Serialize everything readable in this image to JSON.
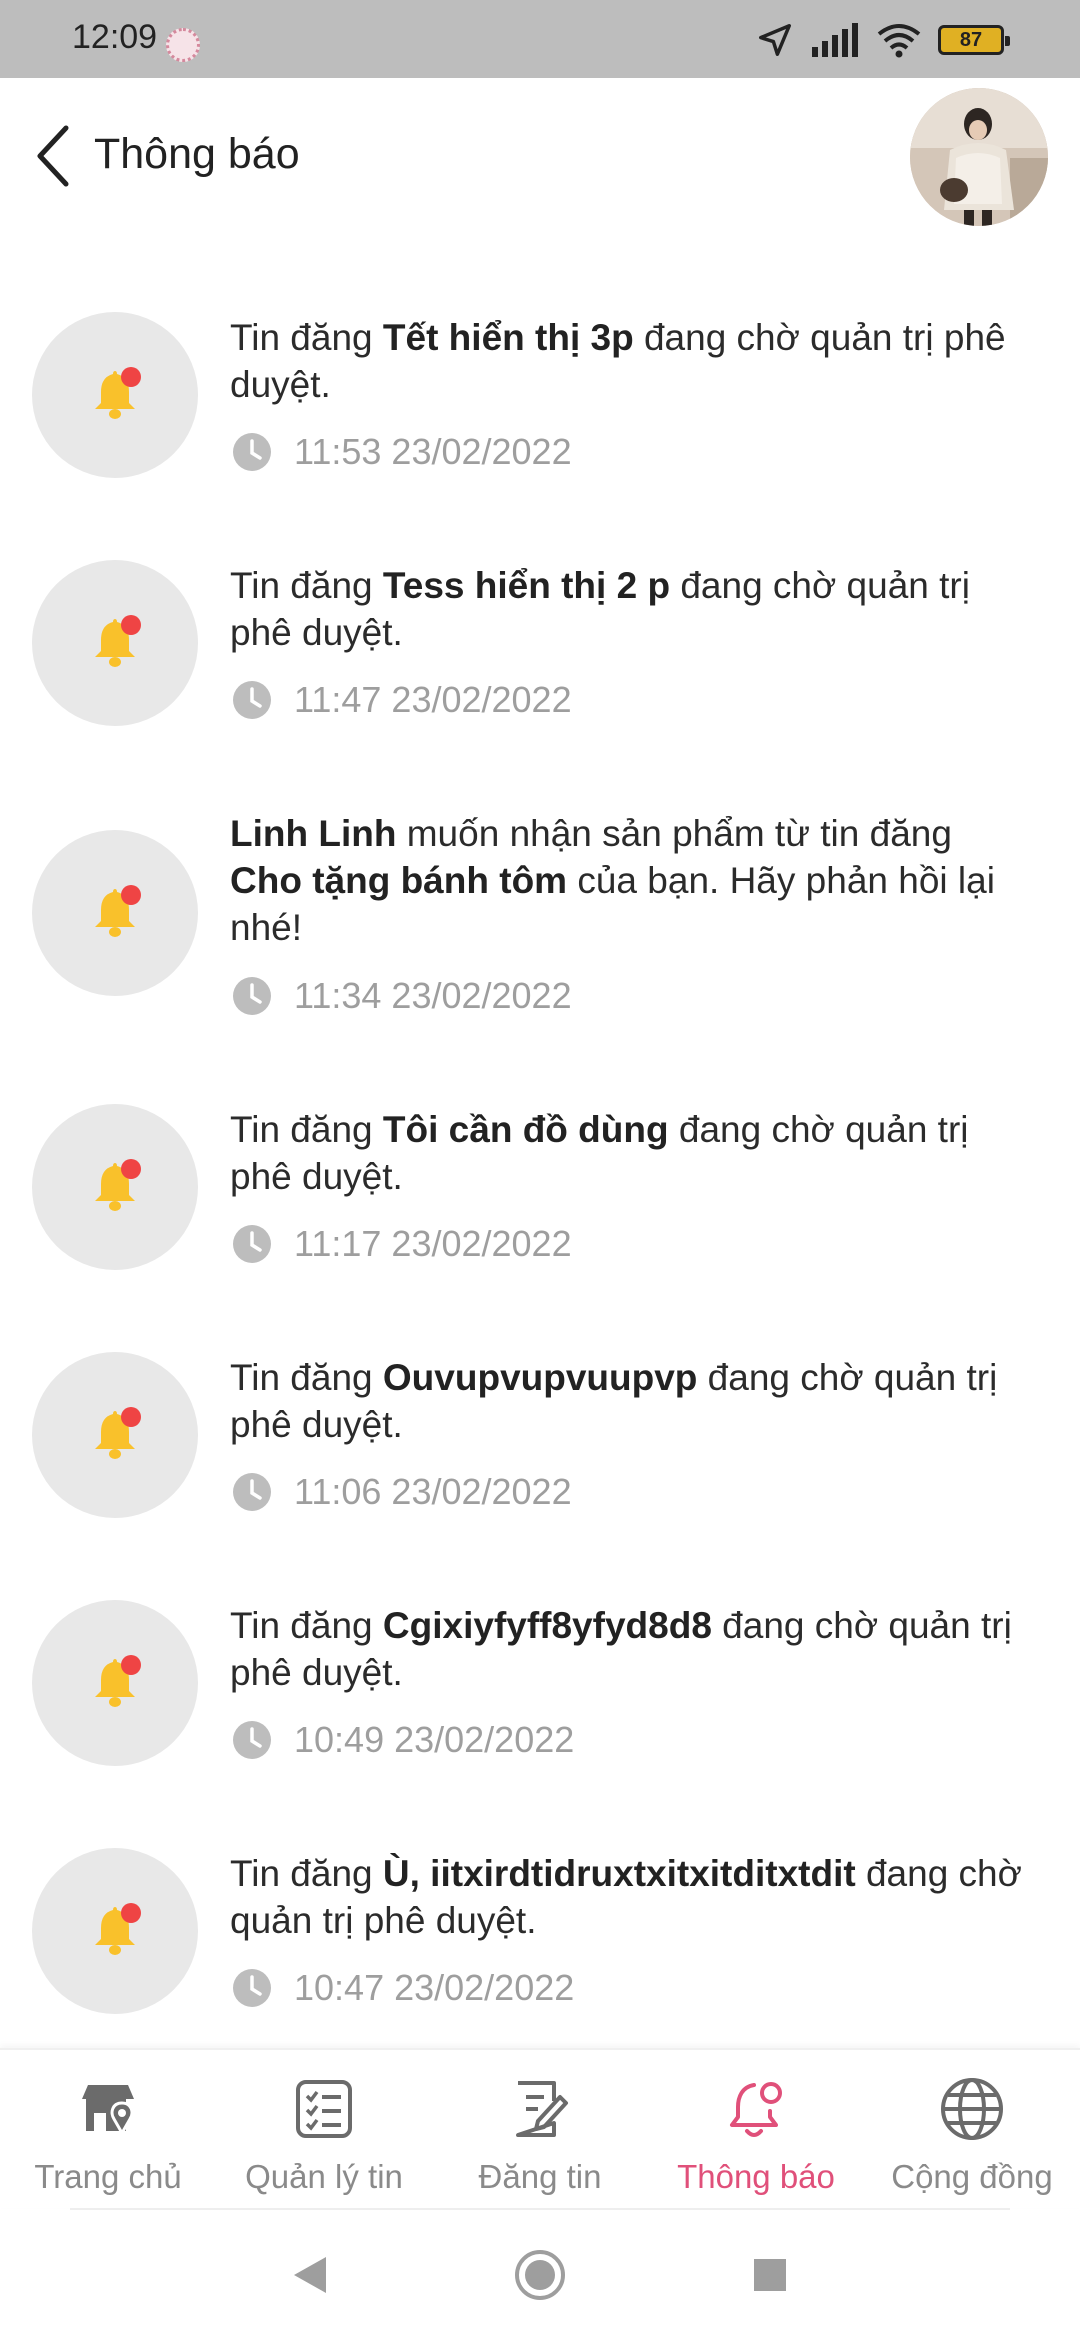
{
  "status_bar": {
    "time": "12:09",
    "battery": "87"
  },
  "header": {
    "title": "Thông báo"
  },
  "notifications": [
    {
      "parts": [
        {
          "t": "Tin đăng ",
          "b": false
        },
        {
          "t": "Tết hiển thị 3p",
          "b": true
        },
        {
          "t": " đang chờ quản trị phê duyệt.",
          "b": false
        }
      ],
      "time": "11:53 23/02/2022"
    },
    {
      "parts": [
        {
          "t": "Tin đăng ",
          "b": false
        },
        {
          "t": "Tess hiển thị 2 p",
          "b": true
        },
        {
          "t": " đang chờ quản trị phê duyệt.",
          "b": false
        }
      ],
      "time": "11:47 23/02/2022"
    },
    {
      "parts": [
        {
          "t": "Linh Linh",
          "b": true
        },
        {
          "t": " muốn nhận sản phẩm từ tin đăng ",
          "b": false
        },
        {
          "t": "Cho tặng bánh tôm ",
          "b": true
        },
        {
          "t": " của bạn. Hãy phản hồi lại nhé!",
          "b": false
        }
      ],
      "time": "11:34 23/02/2022"
    },
    {
      "parts": [
        {
          "t": "Tin đăng ",
          "b": false
        },
        {
          "t": "Tôi cần đồ dùng",
          "b": true
        },
        {
          "t": " đang chờ quản trị phê duyệt.",
          "b": false
        }
      ],
      "time": "11:17 23/02/2022"
    },
    {
      "parts": [
        {
          "t": "Tin đăng ",
          "b": false
        },
        {
          "t": "Ouvupvupvuupvp",
          "b": true
        },
        {
          "t": " đang chờ quản trị phê duyệt.",
          "b": false
        }
      ],
      "time": "11:06 23/02/2022"
    },
    {
      "parts": [
        {
          "t": "Tin đăng ",
          "b": false
        },
        {
          "t": "Cgixiyfyff8yfyd8d8",
          "b": true
        },
        {
          "t": " đang chờ quản trị phê duyệt.",
          "b": false
        }
      ],
      "time": "10:49 23/02/2022"
    },
    {
      "parts": [
        {
          "t": "Tin đăng ",
          "b": false
        },
        {
          "t": "Ù, iitxirdtidruxtxitxitditxtdit",
          "b": true
        },
        {
          "t": " đang chờ quản trị phê duyệt.",
          "b": false
        }
      ],
      "time": "10:47 23/02/2022"
    }
  ],
  "bottom_nav": {
    "items": [
      {
        "label": "Trang chủ",
        "icon": "store-location-icon"
      },
      {
        "label": "Quản lý tin",
        "icon": "checklist-icon"
      },
      {
        "label": "Đăng tin",
        "icon": "edit-post-icon"
      },
      {
        "label": "Thông báo",
        "icon": "bell-icon"
      },
      {
        "label": "Cộng đồng",
        "icon": "globe-icon"
      }
    ],
    "active_index": 3
  },
  "colors": {
    "accent": "#e0507a",
    "bell": "#f9c12b",
    "badge": "#ef4444",
    "status_bar": "#bdbdbd",
    "battery": "#e0b023"
  }
}
